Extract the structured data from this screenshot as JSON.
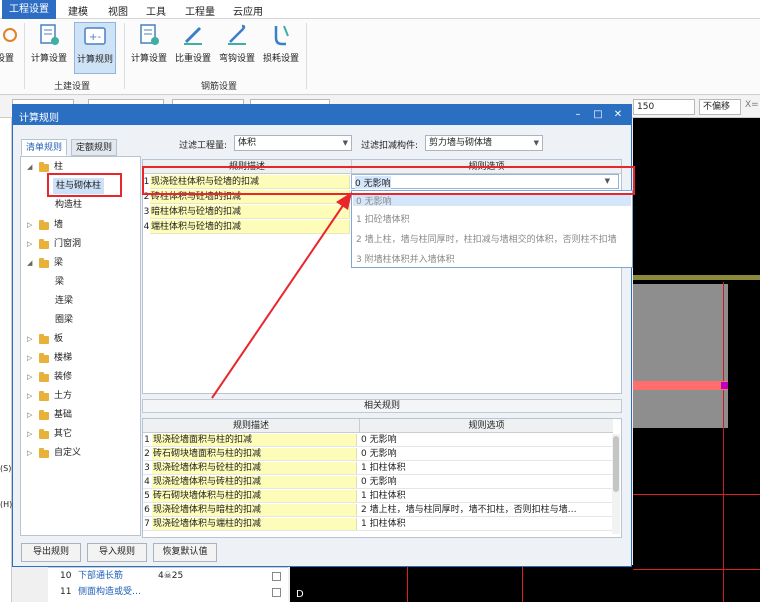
{
  "menu": {
    "items": [
      {
        "label": "工程设置",
        "active": true
      },
      {
        "label": "建模",
        "active": false
      },
      {
        "label": "视图",
        "active": false
      },
      {
        "label": "工具",
        "active": false
      },
      {
        "label": "工程量",
        "active": false
      },
      {
        "label": "云应用",
        "active": false
      }
    ]
  },
  "ribbon": {
    "partial_label": "设置",
    "civil_group": "土建设置",
    "rebar_group": "钢筋设置",
    "civil_buttons": [
      {
        "label": "计算设置"
      },
      {
        "label": "计算规则"
      }
    ],
    "rebar_buttons": [
      {
        "label": "计算设置"
      },
      {
        "label": "比重设置"
      },
      {
        "label": "弯钩设置"
      },
      {
        "label": "损耗设置"
      }
    ]
  },
  "strip": {
    "value": "150",
    "offset_select": "不偏移",
    "x_label": "X="
  },
  "dialog": {
    "title": "计算规则",
    "tabs": [
      {
        "label": "清单规则",
        "active": true
      },
      {
        "label": "定额规则",
        "active": false
      }
    ],
    "filter_qty_label": "过滤工程量:",
    "filter_qty_value": "体积",
    "filter_comp_label": "过滤扣减构件:",
    "filter_comp_value": "剪力墙与砌体墙",
    "tree": [
      {
        "label": "柱",
        "level": 0,
        "expanded": true,
        "folder": true
      },
      {
        "label": "柱与砌体柱",
        "level": 1,
        "selected": true
      },
      {
        "label": "构造柱",
        "level": 1
      },
      {
        "label": "墙",
        "level": 0,
        "folder": true
      },
      {
        "label": "门窗洞",
        "level": 0,
        "folder": true
      },
      {
        "label": "梁",
        "level": 0,
        "expanded": true,
        "folder": true
      },
      {
        "label": "梁",
        "level": 1
      },
      {
        "label": "连梁",
        "level": 1
      },
      {
        "label": "圈梁",
        "level": 1
      },
      {
        "label": "板",
        "level": 0,
        "folder": true
      },
      {
        "label": "楼梯",
        "level": 0,
        "folder": true
      },
      {
        "label": "装修",
        "level": 0,
        "folder": true
      },
      {
        "label": "土方",
        "level": 0,
        "folder": true
      },
      {
        "label": "基础",
        "level": 0,
        "folder": true
      },
      {
        "label": "其它",
        "level": 0,
        "folder": true
      },
      {
        "label": "自定义",
        "level": 0,
        "folder": true
      }
    ],
    "rule_table": {
      "headers": [
        "规则描述",
        "规则选项"
      ],
      "rows": [
        {
          "num": "1",
          "desc": "现浇砼柱体积与砼墙的扣减",
          "option": "0 无影响"
        },
        {
          "num": "2",
          "desc": "砖柱体积与砼墙的扣减",
          "option": ""
        },
        {
          "num": "3",
          "desc": "暗柱体积与砼墙的扣减",
          "option": ""
        },
        {
          "num": "4",
          "desc": "端柱体积与砼墙的扣减",
          "option": ""
        }
      ]
    },
    "dropdown": {
      "options": [
        "0 无影响",
        "1 扣砼墙体积",
        "2 墙上柱，墙与柱同厚时，柱扣减与墙相交的体积，否则柱不扣墙",
        "3 附墙柱体积并入墙体积"
      ]
    },
    "related_label": "相关规则",
    "related_table": {
      "headers": [
        "规则描述",
        "规则选项"
      ],
      "rows": [
        {
          "num": "1",
          "desc": "现浇砼墙面积与柱的扣减",
          "option": "0  无影响"
        },
        {
          "num": "2",
          "desc": "砖石砌块墙面积与柱的扣减",
          "option": "0  无影响"
        },
        {
          "num": "3",
          "desc": "现浇砼墙体积与砼柱的扣减",
          "option": "1  扣柱体积"
        },
        {
          "num": "4",
          "desc": "现浇砼墙体积与砖柱的扣减",
          "option": "0  无影响"
        },
        {
          "num": "5",
          "desc": "砖石砌块墙体积与柱的扣减",
          "option": "1  扣柱体积"
        },
        {
          "num": "6",
          "desc": "现浇砼墙体积与暗柱的扣减",
          "option": "2  墙上柱，墙与柱同厚时，墙不扣柱，否则扣柱与墙…"
        },
        {
          "num": "7",
          "desc": "现浇砼墙体积与端柱的扣减",
          "option": "1  扣柱体积"
        }
      ]
    },
    "buttons": {
      "export": "导出规则",
      "import": "导入规则",
      "restore": "恢复默认值"
    }
  },
  "bottom_rows": [
    {
      "num": "10",
      "name": "下部通长筋",
      "value": "4☠25"
    },
    {
      "num": "11",
      "name": "侧面构造或受…",
      "value": ""
    }
  ],
  "left_edge": {
    "s_label": "(S)",
    "h_label": "(H)"
  },
  "cad_label": "D",
  "colors": {
    "accent": "#2a6fc2",
    "highlight": "#e8262b",
    "rule_cell": "#fdfcb8"
  }
}
